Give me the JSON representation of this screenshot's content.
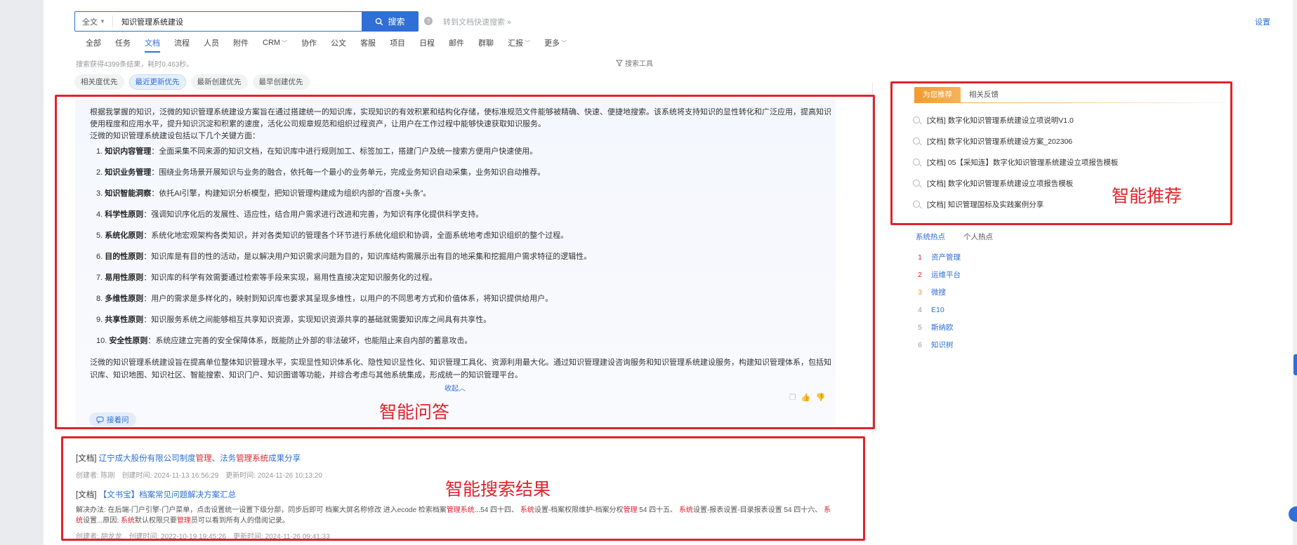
{
  "search": {
    "scope": "全文",
    "query": "知识管理系统建设",
    "button_label": "搜索",
    "fast_search_label": "转到文档快速搜索"
  },
  "header": {
    "settings_label": "设置"
  },
  "nav": {
    "tabs": [
      {
        "label": "全部",
        "dropdown": false
      },
      {
        "label": "任务",
        "dropdown": false
      },
      {
        "label": "文档",
        "dropdown": false,
        "active": true
      },
      {
        "label": "流程",
        "dropdown": false
      },
      {
        "label": "人员",
        "dropdown": false
      },
      {
        "label": "附件",
        "dropdown": false
      },
      {
        "label": "CRM",
        "dropdown": true
      },
      {
        "label": "协作",
        "dropdown": false
      },
      {
        "label": "公文",
        "dropdown": false
      },
      {
        "label": "客服",
        "dropdown": false
      },
      {
        "label": "项目",
        "dropdown": false
      },
      {
        "label": "日程",
        "dropdown": false
      },
      {
        "label": "邮件",
        "dropdown": false
      },
      {
        "label": "群聊",
        "dropdown": false
      },
      {
        "label": "汇报",
        "dropdown": true
      },
      {
        "label": "更多",
        "dropdown": true
      }
    ]
  },
  "stats": {
    "text": "搜索获得4399条结果，耗时0.463秒。",
    "search_tool_label": "搜索工具"
  },
  "sort": {
    "options": [
      "相关度优先",
      "最近更新优先",
      "最新创建优先",
      "最早创建优先"
    ],
    "active_index": 1
  },
  "annotations": {
    "qa_label": "智能问答",
    "rec_label": "智能推荐",
    "results_label": "智能搜索结果"
  },
  "ai_answer": {
    "intro": "根据我掌握的知识，泛微的知识管理系统建设方案旨在通过搭建统一的知识库，实现知识的有效积累和结构化存储，使标准规范文件能够被精确、快速、便捷地搜索。该系统将支持知识的显性转化和广泛应用，提高知识使用程度和应用水平，提升知识沉淀和积累的速度，活化公司规章规范和组织过程资产，让用户在工作过程中能够快速获取知识服务。",
    "lead": "泛微的知识管理系统建设包括以下几个关键方面：",
    "points": [
      {
        "num": "1.",
        "title": "知识内容管理",
        "text": "：全面采集不同来源的知识文档，在知识库中进行规则加工、标签加工，搭建门户及统一搜索方便用户快速使用。"
      },
      {
        "num": "2.",
        "title": "知识业务管理",
        "text": "：围绕业务场景开展知识与业务的融合，依托每一个最小的业务单元，完成业务知识自动采集，业务知识自动推荐。"
      },
      {
        "num": "3.",
        "title": "知识智能洞察",
        "text": "：依托AI引擎，构建知识分析模型，把知识管理构建成为组织内部的“百度+头条”。"
      },
      {
        "num": "4.",
        "title": "科学性原则",
        "text": "：强调知识序化后的发展性、适应性，结合用户需求进行改进和完善，为知识有序化提供科学支持。"
      },
      {
        "num": "5.",
        "title": "系统化原则",
        "text": "：系统化地宏观架构各类知识，并对各类知识的管理各个环节进行系统化组织和协调，全面系统地考虑知识组织的整个过程。"
      },
      {
        "num": "6.",
        "title": "目的性原则",
        "text": "：知识库是有目的性的活动，是以解决用户知识需求问题为目的，知识库结构需展示出有目的地采集和挖掘用户需求特征的逻辑性。"
      },
      {
        "num": "7.",
        "title": "易用性原则",
        "text": "：知识库的科学有效需要通过检索等手段来实现，易用性直接决定知识服务化的过程。"
      },
      {
        "num": "8.",
        "title": "多维性原则",
        "text": "：用户的需求是多样化的，映射到知识库也要求其呈现多维性，以用户的不同思考方式和价值体系，将知识提供给用户。"
      },
      {
        "num": "9.",
        "title": "共享性原则",
        "text": "：知识服务系统之间能够相互共享知识资源，实现知识资源共享的基础就需要知识库之间具有共享性。"
      },
      {
        "num": "10.",
        "title": "安全性原则",
        "text": "：系统应建立完善的安全保障体系，既能防止外部的非法破坏，也能阻止来自内部的蓄意攻击。"
      }
    ],
    "closing": "泛微的知识管理系统建设旨在提高单位整体知识管理水平，实现显性知识体系化、隐性知识显性化、知识管理工具化、资源利用最大化。通过知识管理建设咨询服务和知识管理系统建设服务，构建知识管理体系，包括知识库、知识地图、知识社区、智能搜索、知识门户、知识图谱等功能，并综合考虑与其他系统集成，形成统一的知识管理平台。",
    "collapse_label": "收起",
    "continue_label": "接着问"
  },
  "results": [
    {
      "type_tag": "[文档]",
      "title_parts": [
        {
          "text": "辽宁成大股份有限公司制度",
          "hl": false
        },
        {
          "text": "管理",
          "hl": true
        },
        {
          "text": "、法务",
          "hl": false
        },
        {
          "text": "管理系统",
          "hl": true
        },
        {
          "text": "成果分享",
          "hl": false
        }
      ],
      "creator": "创建者: 陈刚",
      "created": "创建时间: 2024-11-13 16:56:29",
      "updated": "更新时间: 2024-11-26 10:13:20"
    },
    {
      "type_tag": "[文档]",
      "title_parts": [
        {
          "text": "【文书宝】档案常见问题解决方案汇总",
          "hl": false
        }
      ],
      "snippet_parts": [
        {
          "text": "解决办法: 在后端-门户引擎-门户菜单，点击设置统一设置下级分部，同步后即可 档案大屏名称修改 进入ecode 检索档案",
          "hl": false
        },
        {
          "text": "管理系统",
          "hl": true
        },
        {
          "text": "...54 四十四、 ",
          "hl": false
        },
        {
          "text": "系统",
          "hl": true
        },
        {
          "text": "设置-档案权限维护-档案分权",
          "hl": false
        },
        {
          "text": "管理",
          "hl": true
        },
        {
          "text": " 54 四十五、 ",
          "hl": false
        },
        {
          "text": "系统",
          "hl": true
        },
        {
          "text": "设置-报表设置-目录报表设置 54 四十六、 ",
          "hl": false
        },
        {
          "text": "系统",
          "hl": true
        },
        {
          "text": "设置...原因: ",
          "hl": false
        },
        {
          "text": "系统",
          "hl": true
        },
        {
          "text": "默认权限只要",
          "hl": false
        },
        {
          "text": "管理",
          "hl": true
        },
        {
          "text": "员可以看到所有人的借阅记录。",
          "hl": false
        }
      ],
      "creator": "创建者: 胡龙龙",
      "created": "创建时间: 2022-10-19 19:45:26",
      "updated": "更新时间: 2024-11-26 09:41:33"
    }
  ],
  "recommend": {
    "tabs": [
      "为您推荐",
      "相关反馈"
    ],
    "active_index": 0,
    "items": [
      "[文档] 数字化知识管理系统建设立项说明V1.0",
      "[文档] 数字化知识管理系统建设方案_202306",
      "[文档] 05【采知连】数字化知识管理系统建设立项报告模板",
      "[文档] 数字化知识管理系统建设立项报告模板",
      "[文档] 知识管理国标及实践案例分享"
    ]
  },
  "hot": {
    "tabs": [
      "系统热点",
      "个人热点"
    ],
    "active_index": 0,
    "items": [
      {
        "rank": "1",
        "name": "资产管理",
        "color": "#e0232b"
      },
      {
        "rank": "2",
        "name": "运维平台",
        "color": "#e0232b"
      },
      {
        "rank": "3",
        "name": "微搜",
        "color": "#f2912c"
      },
      {
        "rank": "4",
        "name": "E10",
        "color": "#999999"
      },
      {
        "rank": "5",
        "name": "斯纳欧",
        "color": "#999999"
      },
      {
        "rank": "6",
        "name": "知识树",
        "color": "#999999"
      }
    ]
  }
}
